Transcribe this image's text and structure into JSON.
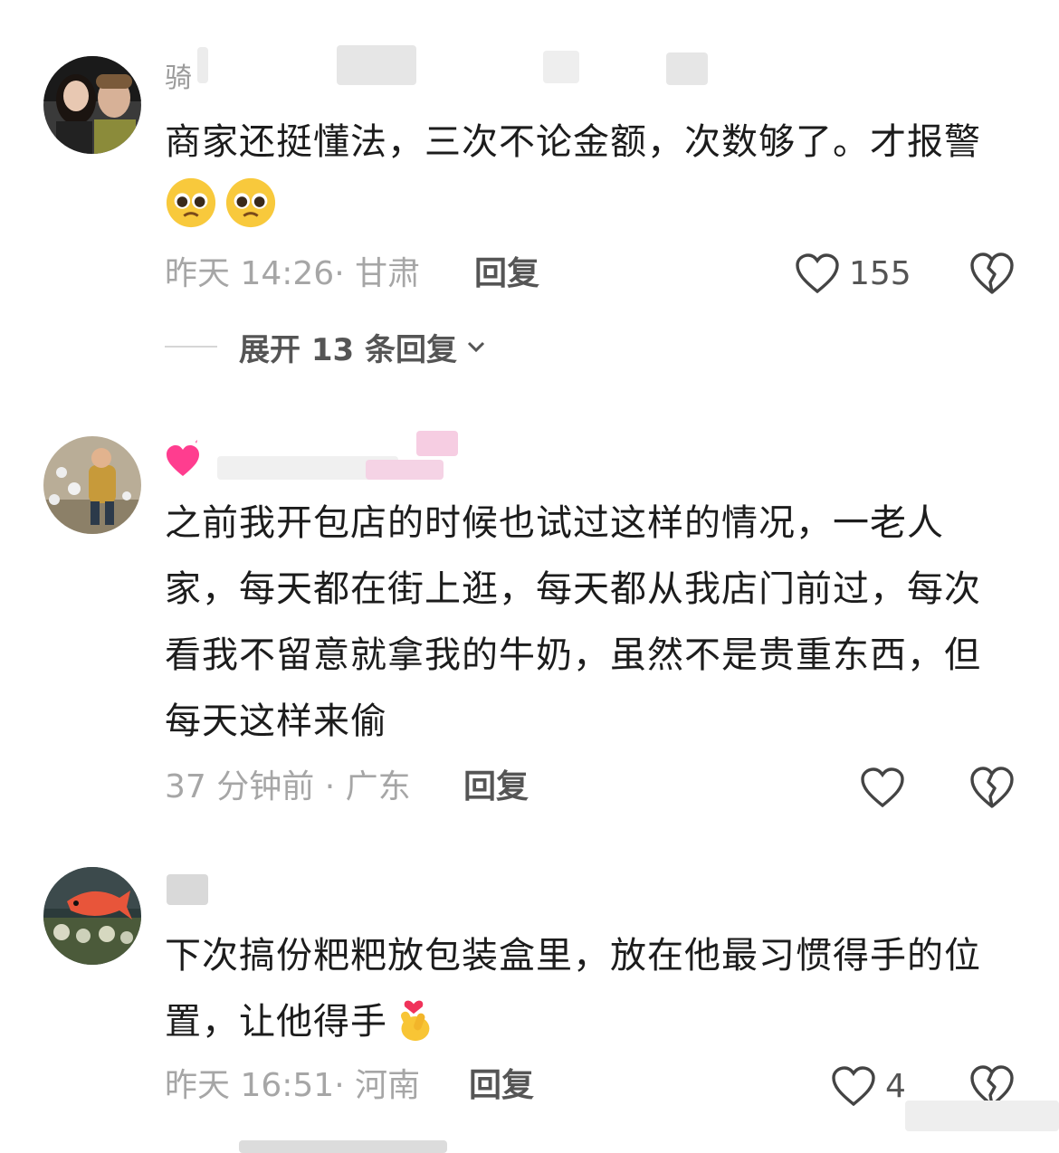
{
  "comments": [
    {
      "username": "骑",
      "text": "商家还挺懂法，三次不论金额，次数够了。才报警",
      "time": "昨天 14:26·",
      "location": "甘肃",
      "reply_label": "回复",
      "likes": "155",
      "expand_label": "展开 13 条回复",
      "emoji_icons": [
        "pleading-face-icon",
        "pleading-face-icon"
      ]
    },
    {
      "username": "",
      "text": "之前我开包店的时候也试过这样的情况，一老人家，每天都在街上逛，每天都从我店门前过，每次看我不留意就拿我的牛奶，虽然不是贵重东西，但每天这样来偷",
      "time": "37 分钟前 ·",
      "location": "广东",
      "reply_label": "回复",
      "likes": "",
      "emoji_icons": [
        "sparkling-heart-icon"
      ]
    },
    {
      "username": "",
      "text": "下次搞份粑粑放包装盒里，放在他最习惯得手的位置，让他得手",
      "time": "昨天 16:51·",
      "location": "河南",
      "reply_label": "回复",
      "likes": "4",
      "emoji_icons": [
        "finger-heart-icon"
      ]
    }
  ],
  "colors": {
    "text": "#1c1c1c",
    "meta": "#a6a6a6",
    "action": "#555555"
  }
}
